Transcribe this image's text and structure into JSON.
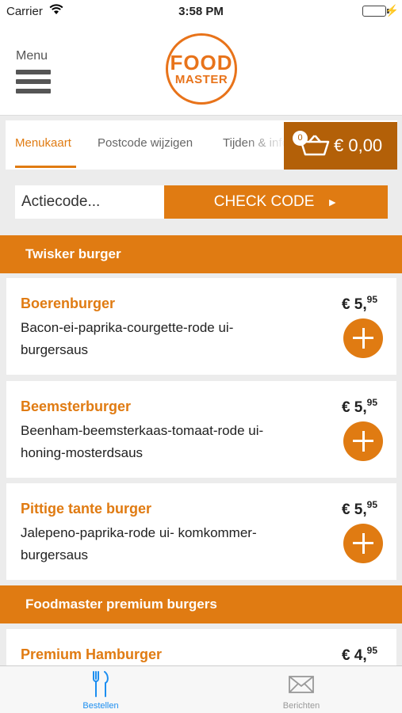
{
  "status_bar": {
    "carrier": "Carrier",
    "time": "3:58 PM"
  },
  "header": {
    "menu_label": "Menu",
    "logo_line1": "FOOD",
    "logo_line2": "MASTER"
  },
  "tabs": [
    {
      "label": "Menukaart",
      "active": true
    },
    {
      "label": "Postcode wijzigen",
      "active": false
    },
    {
      "label": "Tijden & info",
      "active": false
    }
  ],
  "cart": {
    "count": "0",
    "total": "€ 0,00"
  },
  "action_code": {
    "placeholder": "Actiecode...",
    "button_label": "CHECK CODE",
    "button_arrow": "►"
  },
  "sections": [
    {
      "title": "Twisker burger",
      "items": [
        {
          "name": "Boerenburger",
          "description": "Bacon-ei-paprika-courgette-rode ui-burgersaus",
          "price_main": "€ 5,",
          "price_cents": "95"
        },
        {
          "name": "Beemsterburger",
          "description": "Beenham-beemsterkaas-tomaat-rode ui-honing-mosterdsaus",
          "price_main": "€ 5,",
          "price_cents": "95"
        },
        {
          "name": "Pittige tante burger",
          "description": "Jalepeno-paprika-rode ui- komkommer-burgersaus",
          "price_main": "€ 5,",
          "price_cents": "95"
        }
      ]
    },
    {
      "title": "Foodmaster premium burgers",
      "items": [
        {
          "name": "Premium Hamburger",
          "description": "",
          "price_main": "€ 4,",
          "price_cents": "95"
        }
      ]
    }
  ],
  "tabbar": [
    {
      "label": "Bestellen",
      "icon": "fork-knife-icon",
      "active": true
    },
    {
      "label": "Berichten",
      "icon": "envelope-icon",
      "active": false
    }
  ],
  "colors": {
    "accent": "#e07b12",
    "cart_bg": "#b36008",
    "tab_active": "#1c8ef0",
    "battery": "#4cd964"
  }
}
